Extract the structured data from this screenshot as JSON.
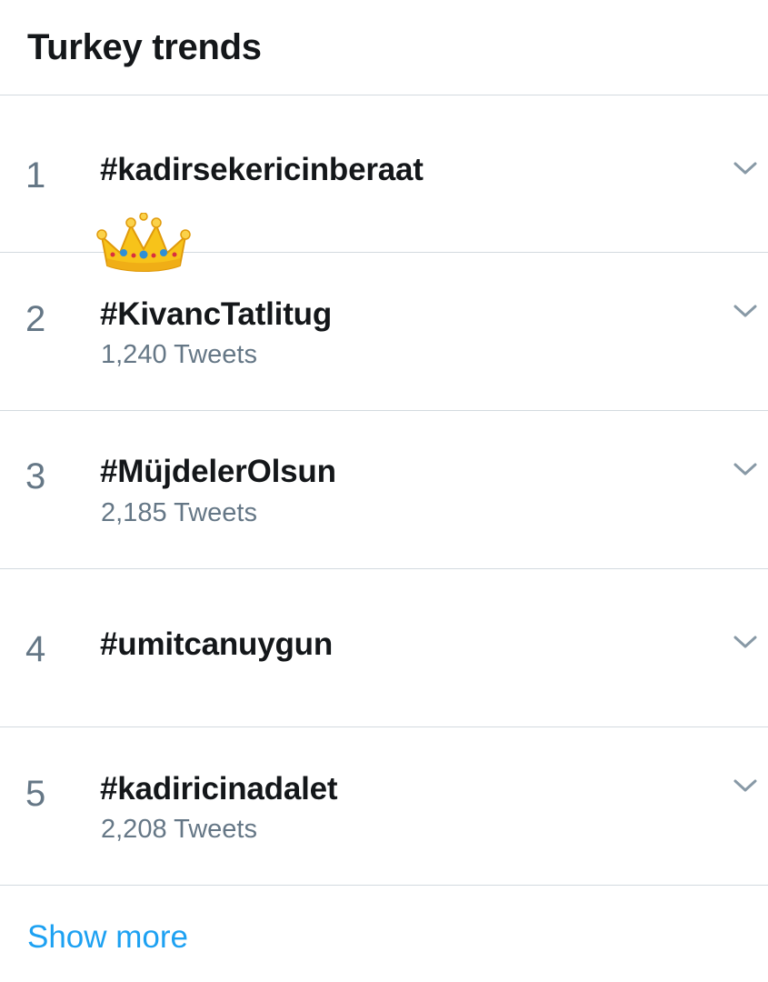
{
  "header": {
    "title": "Turkey trends"
  },
  "trends": [
    {
      "rank": "1",
      "name": "#kadirsekericinberaat",
      "count": ""
    },
    {
      "rank": "2",
      "name": "#KivancTatlitug",
      "count": "1,240 Tweets"
    },
    {
      "rank": "3",
      "name": "#MüjdelerOlsun",
      "count": "2,185 Tweets"
    },
    {
      "rank": "4",
      "name": "#umitcanuygun",
      "count": ""
    },
    {
      "rank": "5",
      "name": "#kadiricinadalet",
      "count": "2,208 Tweets"
    }
  ],
  "footer": {
    "show_more_label": "Show more"
  },
  "colors": {
    "accent": "#1da1f2",
    "secondary_text": "#657786",
    "divider": "#d3dadf"
  },
  "icons": {
    "chevron": "chevron-down-icon",
    "crown": "crown-emoji"
  }
}
